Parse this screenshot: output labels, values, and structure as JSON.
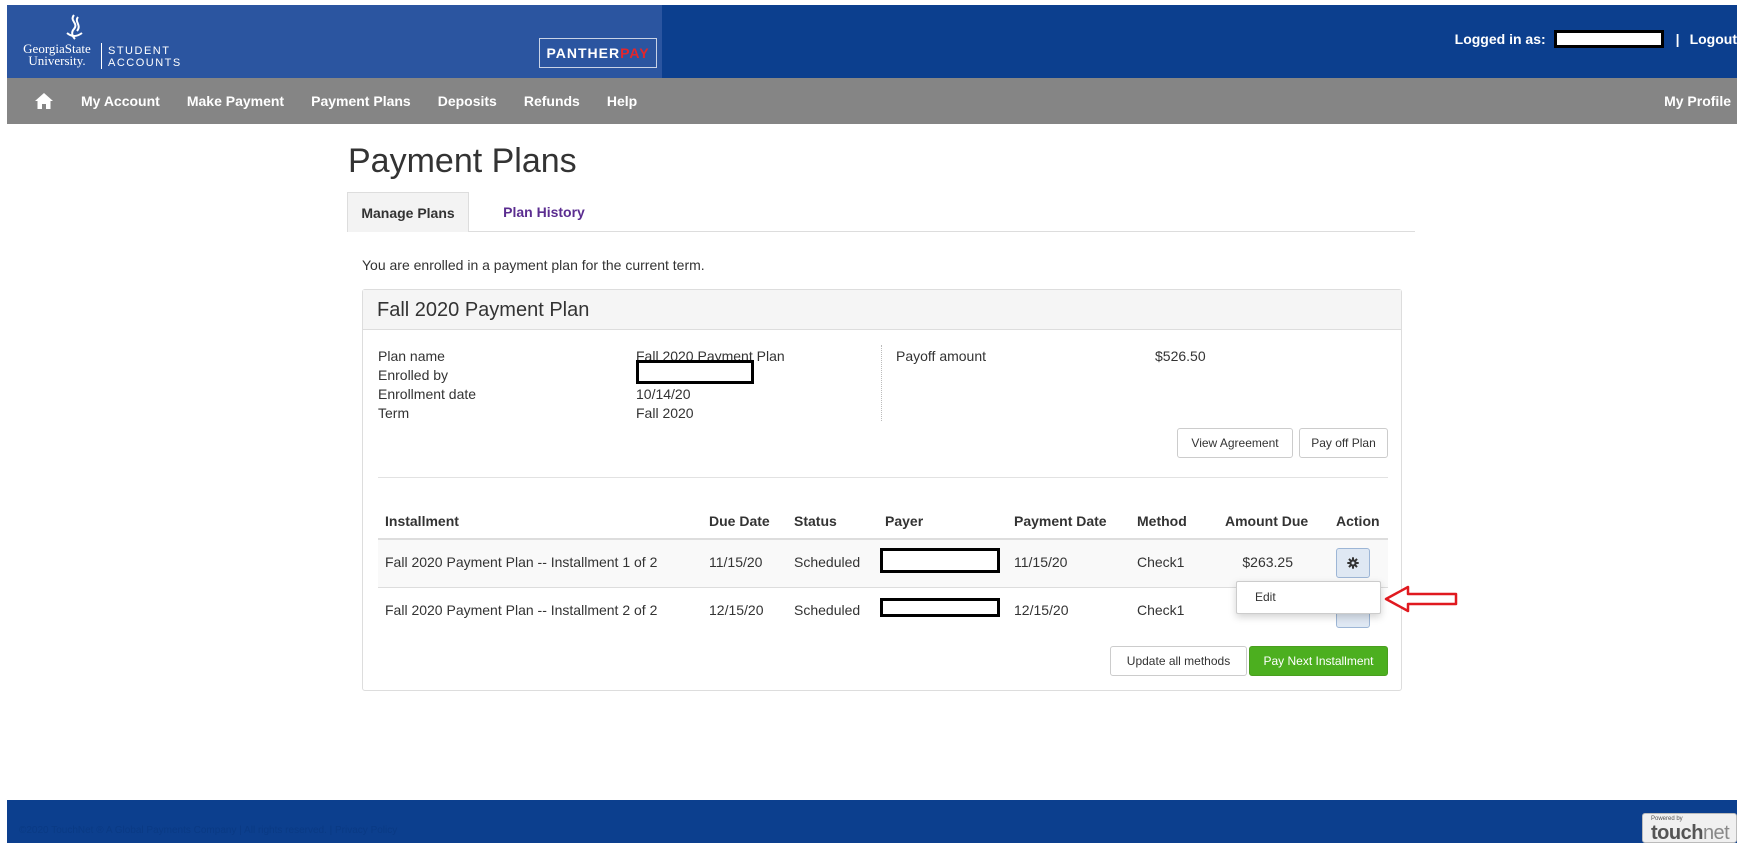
{
  "header": {
    "logo_name_line1": "GeorgiaState",
    "logo_name_line2": "University.",
    "logo_dept_line1": "STUDENT",
    "logo_dept_line2": "ACCOUNTS",
    "panther_part1": "PANTHER",
    "panther_part2": "PAY",
    "logged_in_label": "Logged in as:",
    "separator": "|",
    "logout_label": "Logout"
  },
  "nav": {
    "items": [
      "My Account",
      "Make Payment",
      "Payment Plans",
      "Deposits",
      "Refunds",
      "Help"
    ],
    "right_item": "My Profile"
  },
  "page": {
    "title": "Payment Plans",
    "tabs": [
      "Manage Plans",
      "Plan History"
    ],
    "enrolled_message": "You are enrolled in a payment plan for the current term."
  },
  "plan": {
    "heading": "Fall 2020 Payment Plan",
    "labels": {
      "plan_name": "Plan name",
      "enrolled_by": "Enrolled by",
      "enrollment_date": "Enrollment date",
      "term": "Term",
      "payoff_amount": "Payoff amount"
    },
    "values": {
      "plan_name": "Fall 2020 Payment Plan",
      "enrollment_date": "10/14/20",
      "term": "Fall 2020",
      "payoff_amount": "$526.50"
    },
    "buttons": {
      "view_agreement": "View Agreement",
      "pay_off_plan": "Pay off Plan",
      "update_all_methods": "Update all methods",
      "pay_next_installment": "Pay Next Installment"
    }
  },
  "table": {
    "columns": [
      "Installment",
      "Due Date",
      "Status",
      "Payer",
      "Payment Date",
      "Method",
      "Amount Due",
      "Action"
    ],
    "rows": [
      {
        "installment": "Fall 2020 Payment Plan -- Installment 1 of 2",
        "due_date": "11/15/20",
        "status": "Scheduled",
        "payment_date": "11/15/20",
        "method": "Check1",
        "amount_due": "$263.25"
      },
      {
        "installment": "Fall 2020 Payment Plan -- Installment 2 of 2",
        "due_date": "12/15/20",
        "status": "Scheduled",
        "payment_date": "12/15/20",
        "method": "Check1",
        "amount_due": ""
      }
    ],
    "action_menu": {
      "items": [
        "Edit"
      ]
    }
  },
  "footer": {
    "copyright": "©2020 TouchNet ® A Global Payments Company | All rights reserved. | Privacy Policy",
    "powered_by": "Powered by",
    "touchnet_part1": "touch",
    "touchnet_part2": "net"
  },
  "colors": {
    "header_blue": "#0c3f8e",
    "nav_gray": "#858585",
    "tab_link_purple": "#5b2d90",
    "primary_green": "#4caf1f",
    "annotation_red": "#e0191f"
  }
}
